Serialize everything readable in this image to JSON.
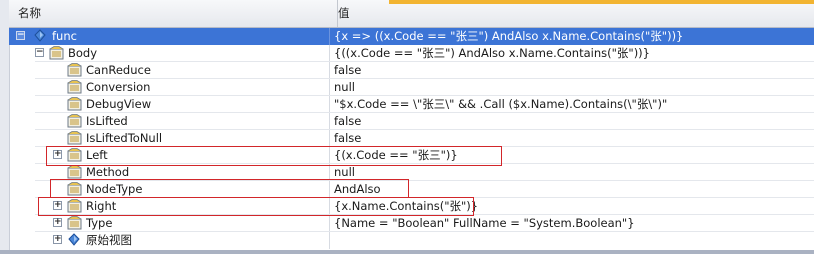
{
  "columns": {
    "name": "名称",
    "value": "值"
  },
  "rows": [
    {
      "label": "func",
      "value": "{x => ((x.Code == \"张三\") AndAlso x.Name.Contains(\"张\"))}"
    },
    {
      "label": "Body",
      "value": "{((x.Code == \"张三\") AndAlso x.Name.Contains(\"张\"))}"
    },
    {
      "label": "CanReduce",
      "value": "false"
    },
    {
      "label": "Conversion",
      "value": "null"
    },
    {
      "label": "DebugView",
      "value": "\"$x.Code == \\\"张三\\\" && .Call ($x.Name).Contains(\\\"张\\\")\""
    },
    {
      "label": "IsLifted",
      "value": "false"
    },
    {
      "label": "IsLiftedToNull",
      "value": "false"
    },
    {
      "label": "Left",
      "value": "{(x.Code == \"张三\")}"
    },
    {
      "label": "Method",
      "value": "null"
    },
    {
      "label": "NodeType",
      "value": "AndAlso"
    },
    {
      "label": "Right",
      "value": "{x.Name.Contains(\"张\")}"
    },
    {
      "label": "Type",
      "value": "{Name = \"Boolean\" FullName = \"System.Boolean\"}"
    },
    {
      "label": "原始视图",
      "value": ""
    }
  ],
  "expanders": {
    "expanded": "−",
    "collapsed": "+"
  },
  "colors": {
    "selection": "#3c74d6",
    "highlight_box": "#d2262a",
    "header_accent": "#f2b431"
  },
  "icons": {
    "func": "blue-diamond-icon",
    "property": "property-card-icon",
    "raw_view": "blue-diamond-icon"
  }
}
